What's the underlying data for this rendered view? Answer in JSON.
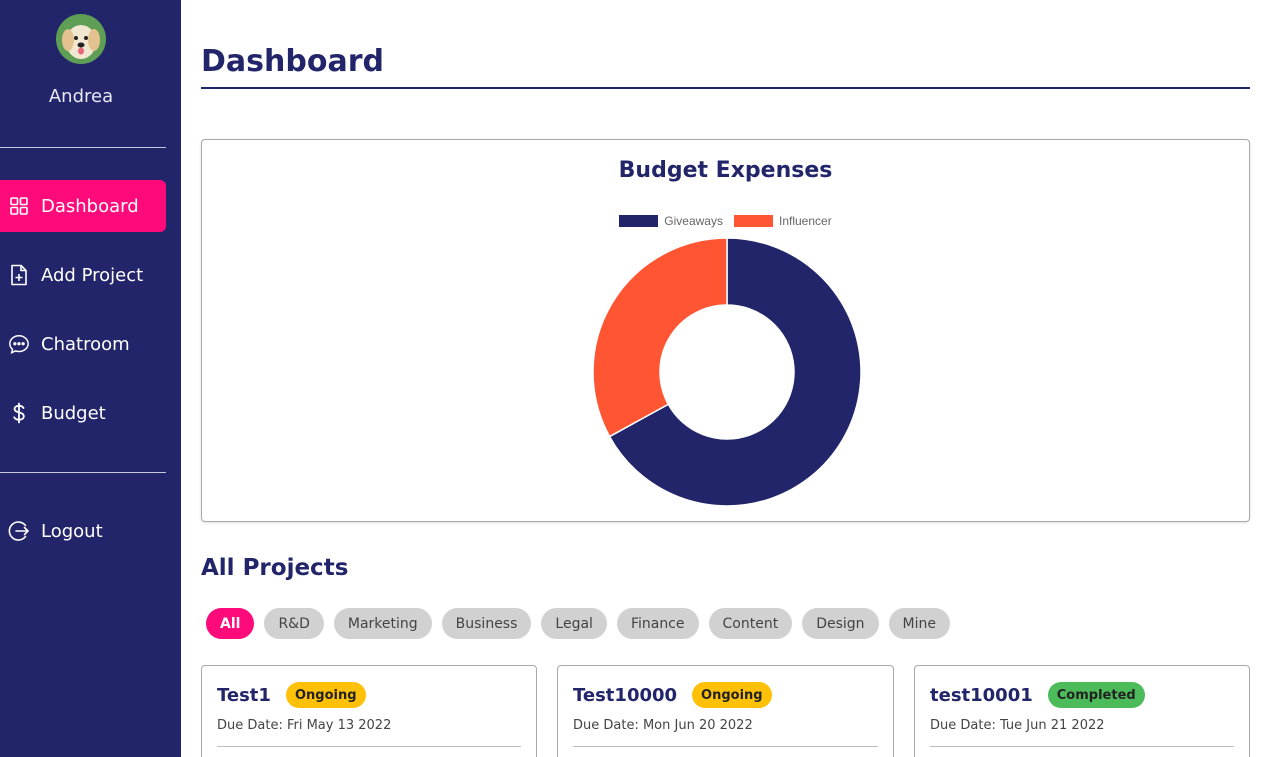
{
  "user": {
    "name": "Andrea"
  },
  "nav": {
    "items": [
      {
        "label": "Dashboard",
        "icon": "grid-icon"
      },
      {
        "label": "Add Project",
        "icon": "file-plus-icon"
      },
      {
        "label": "Chatroom",
        "icon": "chat-icon"
      },
      {
        "label": "Budget",
        "icon": "dollar-icon"
      }
    ],
    "logout_label": "Logout"
  },
  "page": {
    "title": "Dashboard"
  },
  "chart_data": {
    "type": "pie",
    "title": "Budget Expenses",
    "labels": [
      "Giveaways",
      "Influencer"
    ],
    "values": [
      67,
      33
    ],
    "colors": [
      "#23256b",
      "#ff5533"
    ],
    "legend": "top"
  },
  "projects_section": {
    "title": "All Projects",
    "filters": [
      "All",
      "R&D",
      "Marketing",
      "Business",
      "Legal",
      "Finance",
      "Content",
      "Design",
      "Mine"
    ],
    "selected_filter": "All",
    "cards": [
      {
        "name": "Test1",
        "status": "Ongoing",
        "due": "Due Date: Fri May 13 2022"
      },
      {
        "name": "Test10000",
        "status": "Ongoing",
        "due": "Due Date: Mon Jun 20 2022"
      },
      {
        "name": "test10001",
        "status": "Completed",
        "due": "Due Date: Tue Jun 21 2022"
      }
    ]
  },
  "colors": {
    "sidebar": "#23256b",
    "accent": "#ff0a7a",
    "ongoing": "#ffc107",
    "completed": "#4cbb5a"
  }
}
